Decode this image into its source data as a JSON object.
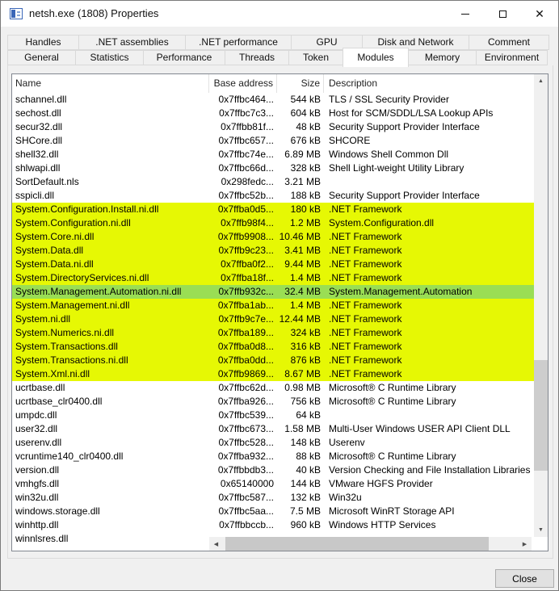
{
  "window": {
    "title": "netsh.exe (1808) Properties"
  },
  "tabs": {
    "row1": [
      "Handles",
      ".NET assemblies",
      ".NET performance",
      "GPU",
      "Disk and Network",
      "Comment"
    ],
    "row2": [
      "General",
      "Statistics",
      "Performance",
      "Threads",
      "Token",
      "Modules",
      "Memory",
      "Environment"
    ],
    "active": "Modules"
  },
  "modules": {
    "columns": [
      "Name",
      "Base address",
      "Size",
      "Description"
    ],
    "rows": [
      {
        "name": "schannel.dll",
        "base": "0x7ffbc464...",
        "size": "544 kB",
        "desc": "TLS / SSL Security Provider",
        "highlight": "none"
      },
      {
        "name": "sechost.dll",
        "base": "0x7ffbc7c3...",
        "size": "604 kB",
        "desc": "Host for SCM/SDDL/LSA Lookup APIs",
        "highlight": "none"
      },
      {
        "name": "secur32.dll",
        "base": "0x7ffbb81f...",
        "size": "48 kB",
        "desc": "Security Support Provider Interface",
        "highlight": "none"
      },
      {
        "name": "SHCore.dll",
        "base": "0x7ffbc657...",
        "size": "676 kB",
        "desc": "SHCORE",
        "highlight": "none"
      },
      {
        "name": "shell32.dll",
        "base": "0x7ffbc74e...",
        "size": "6.89 MB",
        "desc": "Windows Shell Common Dll",
        "highlight": "none"
      },
      {
        "name": "shlwapi.dll",
        "base": "0x7ffbc66d...",
        "size": "328 kB",
        "desc": "Shell Light-weight Utility Library",
        "highlight": "none"
      },
      {
        "name": "SortDefault.nls",
        "base": "0x298fedc...",
        "size": "3.21 MB",
        "desc": "",
        "highlight": "none"
      },
      {
        "name": "sspicli.dll",
        "base": "0x7ffbc52b...",
        "size": "188 kB",
        "desc": "Security Support Provider Interface",
        "highlight": "none"
      },
      {
        "name": "System.Configuration.Install.ni.dll",
        "base": "0x7ffba0d5...",
        "size": "180 kB",
        "desc": ".NET Framework",
        "highlight": "dotnet"
      },
      {
        "name": "System.Configuration.ni.dll",
        "base": "0x7ffb98f4...",
        "size": "1.2 MB",
        "desc": "System.Configuration.dll",
        "highlight": "dotnet"
      },
      {
        "name": "System.Core.ni.dll",
        "base": "0x7ffb9908...",
        "size": "10.46 MB",
        "desc": ".NET Framework",
        "highlight": "dotnet"
      },
      {
        "name": "System.Data.dll",
        "base": "0x7ffb9c23...",
        "size": "3.41 MB",
        "desc": ".NET Framework",
        "highlight": "dotnet"
      },
      {
        "name": "System.Data.ni.dll",
        "base": "0x7ffba0f2...",
        "size": "9.44 MB",
        "desc": ".NET Framework",
        "highlight": "dotnet"
      },
      {
        "name": "System.DirectoryServices.ni.dll",
        "base": "0x7ffba18f...",
        "size": "1.4 MB",
        "desc": ".NET Framework",
        "highlight": "dotnet"
      },
      {
        "name": "System.Management.Automation.ni.dll",
        "base": "0x7ffb932c...",
        "size": "32.4 MB",
        "desc": "System.Management.Automation",
        "highlight": "selected"
      },
      {
        "name": "System.Management.ni.dll",
        "base": "0x7ffba1ab...",
        "size": "1.4 MB",
        "desc": ".NET Framework",
        "highlight": "dotnet"
      },
      {
        "name": "System.ni.dll",
        "base": "0x7ffb9c7e...",
        "size": "12.44 MB",
        "desc": ".NET Framework",
        "highlight": "dotnet"
      },
      {
        "name": "System.Numerics.ni.dll",
        "base": "0x7ffba189...",
        "size": "324 kB",
        "desc": ".NET Framework",
        "highlight": "dotnet"
      },
      {
        "name": "System.Transactions.dll",
        "base": "0x7ffba0d8...",
        "size": "316 kB",
        "desc": ".NET Framework",
        "highlight": "dotnet"
      },
      {
        "name": "System.Transactions.ni.dll",
        "base": "0x7ffba0dd...",
        "size": "876 kB",
        "desc": ".NET Framework",
        "highlight": "dotnet"
      },
      {
        "name": "System.Xml.ni.dll",
        "base": "0x7ffb9869...",
        "size": "8.67 MB",
        "desc": ".NET Framework",
        "highlight": "dotnet"
      },
      {
        "name": "ucrtbase.dll",
        "base": "0x7ffbc62d...",
        "size": "0.98 MB",
        "desc": "Microsoft® C Runtime Library",
        "highlight": "none"
      },
      {
        "name": "ucrtbase_clr0400.dll",
        "base": "0x7ffba926...",
        "size": "756 kB",
        "desc": "Microsoft® C Runtime Library",
        "highlight": "none"
      },
      {
        "name": "umpdc.dll",
        "base": "0x7ffbc539...",
        "size": "64 kB",
        "desc": "",
        "highlight": "none"
      },
      {
        "name": "user32.dll",
        "base": "0x7ffbc673...",
        "size": "1.58 MB",
        "desc": "Multi-User Windows USER API Client DLL",
        "highlight": "none"
      },
      {
        "name": "userenv.dll",
        "base": "0x7ffbc528...",
        "size": "148 kB",
        "desc": "Userenv",
        "highlight": "none"
      },
      {
        "name": "vcruntime140_clr0400.dll",
        "base": "0x7ffba932...",
        "size": "88 kB",
        "desc": "Microsoft® C Runtime Library",
        "highlight": "none"
      },
      {
        "name": "version.dll",
        "base": "0x7ffbbdb3...",
        "size": "40 kB",
        "desc": "Version Checking and File Installation Libraries",
        "highlight": "none"
      },
      {
        "name": "vmhgfs.dll",
        "base": "0x65140000",
        "size": "144 kB",
        "desc": "VMware HGFS Provider",
        "highlight": "none"
      },
      {
        "name": "win32u.dll",
        "base": "0x7ffbc587...",
        "size": "132 kB",
        "desc": "Win32u",
        "highlight": "none"
      },
      {
        "name": "windows.storage.dll",
        "base": "0x7ffbc5aa...",
        "size": "7.5 MB",
        "desc": "Microsoft WinRT Storage API",
        "highlight": "none"
      },
      {
        "name": "winhttp.dll",
        "base": "0x7ffbbccb...",
        "size": "960 kB",
        "desc": "Windows HTTP Services",
        "highlight": "none"
      },
      {
        "name": "winnlsres.dll",
        "base": "",
        "size": "",
        "desc": "",
        "highlight": "none"
      }
    ]
  },
  "footer": {
    "close_label": "Close"
  },
  "icons": {
    "minimize": "minimize-icon",
    "maximize": "maximize-icon",
    "close": "close-icon",
    "scroll_up": "▲",
    "scroll_down": "▼",
    "scroll_left": "◀",
    "scroll_right": "▶"
  },
  "colors": {
    "dotnet_highlight": "#e6f804",
    "selected_row": "#9ade54"
  }
}
